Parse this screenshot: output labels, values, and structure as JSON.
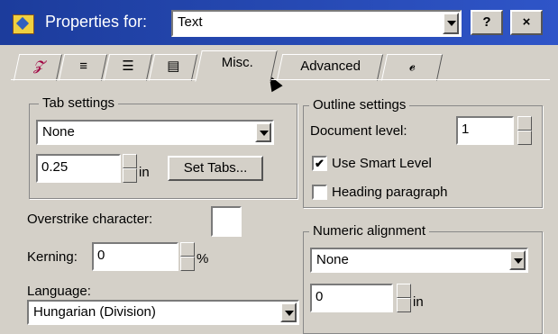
{
  "title": "Properties for:",
  "object_type": "Text",
  "help_icon": "?",
  "close_icon": "×",
  "tabs": [
    {
      "label": "",
      "icon": "font-icon"
    },
    {
      "label": "",
      "icon": "paragraph-icon"
    },
    {
      "label": "",
      "icon": "bullets-icon"
    },
    {
      "label": "",
      "icon": "border-icon"
    },
    {
      "label": "Misc."
    },
    {
      "label": "Advanced"
    },
    {
      "label": "",
      "icon": "style-icon"
    }
  ],
  "tab_settings": {
    "group_label": "Tab settings",
    "mode": "None",
    "value": "0.25",
    "unit": "in",
    "set_tabs_label": "Set Tabs..."
  },
  "outline_settings": {
    "group_label": "Outline settings",
    "document_level_label": "Document level:",
    "document_level": "1",
    "use_smart_level_label": "Use Smart Level",
    "use_smart_level_checked": "✔",
    "heading_paragraph_label": "Heading paragraph"
  },
  "overstrike_label": "Overstrike character:",
  "kerning": {
    "label": "Kerning:",
    "value": "0",
    "unit": "%"
  },
  "language": {
    "label": "Language:",
    "value": "Hungarian (Division)"
  },
  "numeric_alignment": {
    "group_label": "Numeric alignment",
    "mode": "None",
    "value": "0",
    "unit": "in"
  }
}
